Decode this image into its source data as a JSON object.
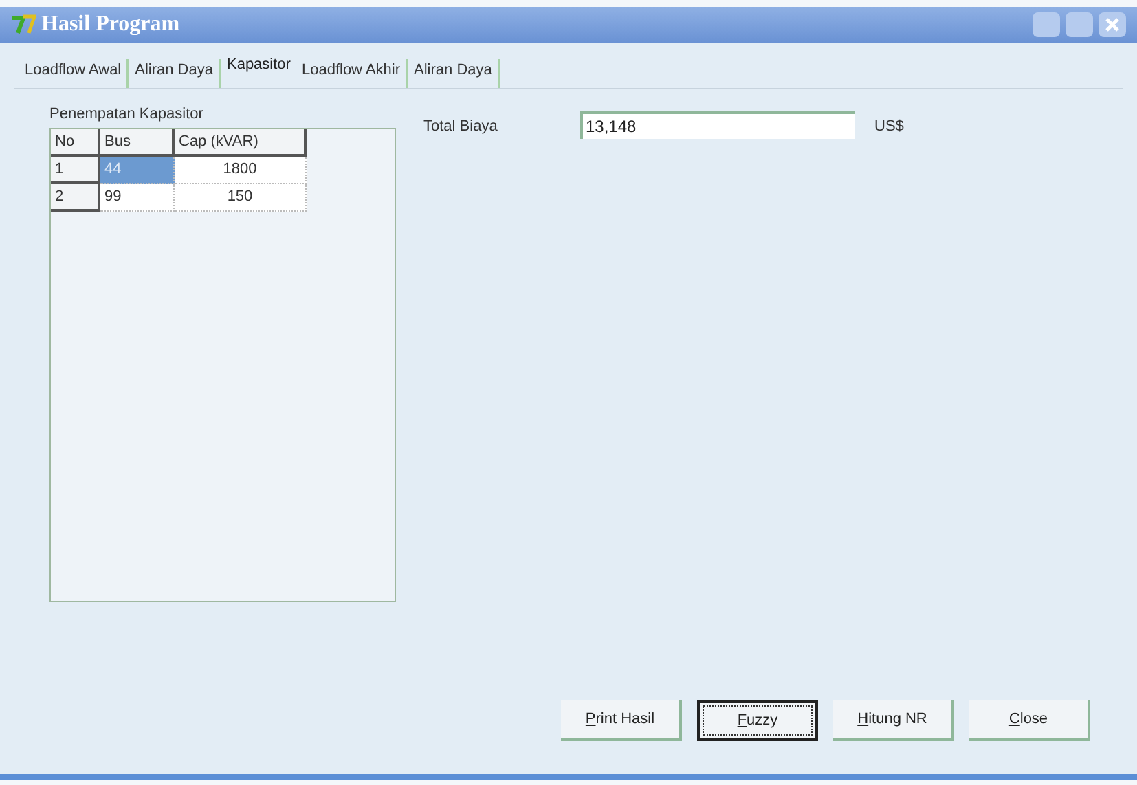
{
  "window": {
    "title": "Hasil Program"
  },
  "tabs": [
    {
      "label": "Loadflow Awal",
      "selected": false
    },
    {
      "label": "Aliran Daya",
      "selected": false
    },
    {
      "label": "Kapasitor",
      "selected": true
    },
    {
      "label": "Loadflow Akhir",
      "selected": false
    },
    {
      "label": "Aliran Daya",
      "selected": false
    }
  ],
  "group": {
    "title": "Penempatan Kapasitor"
  },
  "table": {
    "columns": [
      "No",
      "Bus",
      "Cap (kVAR)"
    ],
    "rows": [
      {
        "cells": [
          {
            "text": "1",
            "selected": false
          },
          {
            "text": "44",
            "selected": true
          },
          {
            "text": "1800",
            "selected": false
          }
        ]
      },
      {
        "cells": [
          {
            "text": "2",
            "selected": false
          },
          {
            "text": "99",
            "selected": false
          },
          {
            "text": "150",
            "selected": false
          }
        ]
      }
    ]
  },
  "total": {
    "label": "Total Biaya",
    "value": "13,148",
    "unit": "US$"
  },
  "buttons": [
    {
      "label": "Print Hasil",
      "default": false
    },
    {
      "label": "Fuzzy",
      "default": true
    },
    {
      "label": "Hitung NR",
      "default": false
    },
    {
      "label": "Close",
      "default": false
    }
  ]
}
